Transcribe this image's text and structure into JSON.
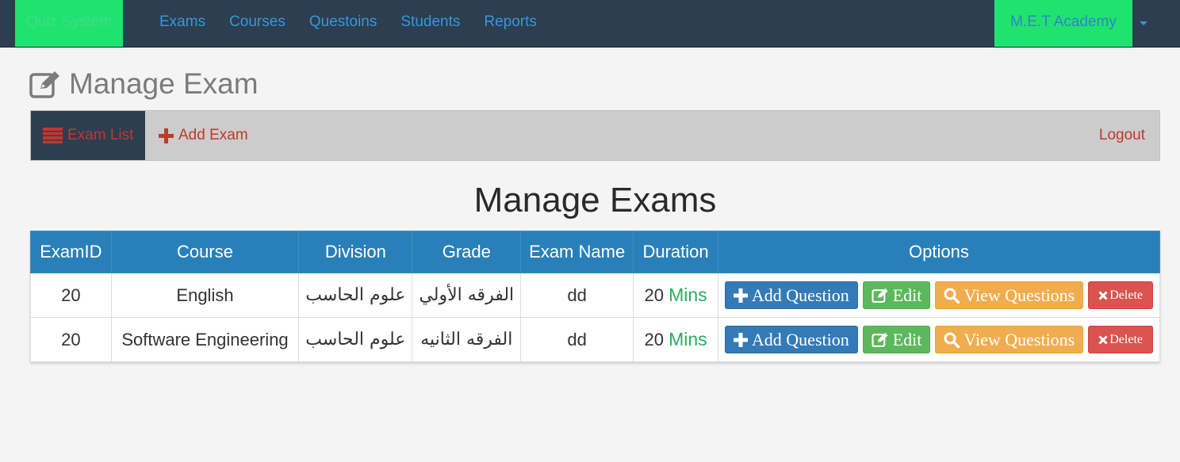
{
  "navbar": {
    "brand": "Quiz System",
    "links": [
      "Exams",
      "Courses",
      "Questoins",
      "Students",
      "Reports"
    ],
    "account": "M.E.T Academy"
  },
  "page": {
    "title": "Manage Exam"
  },
  "subnav": {
    "exam_list": "Exam List",
    "add_exam": "Add Exam",
    "logout": "Logout"
  },
  "section": {
    "heading": "Manage Exams"
  },
  "table": {
    "headers": [
      "ExamID",
      "Course",
      "Division",
      "Grade",
      "Exam Name",
      "Duration",
      "Options"
    ],
    "rows": [
      {
        "exam_id": "20",
        "course": "English",
        "division": "علوم الحاسب",
        "grade": "الفرقه الأولي",
        "exam_name": "dd",
        "duration_value": "20",
        "duration_unit": "Mins"
      },
      {
        "exam_id": "20",
        "course": "Software Engineering",
        "division": "علوم الحاسب",
        "grade": "الفرقه الثانيه",
        "exam_name": "dd",
        "duration_value": "20",
        "duration_unit": "Mins"
      }
    ],
    "buttons": {
      "add_question": "Add Question",
      "edit": "Edit",
      "view_questions": "View Questions",
      "delete": "Delete"
    }
  },
  "colors": {
    "navbar_bg": "#2c3e50",
    "brand_bg": "#20e36f",
    "table_header": "#2980b9",
    "accent_link": "#3498db",
    "danger_text": "#c0392b"
  }
}
